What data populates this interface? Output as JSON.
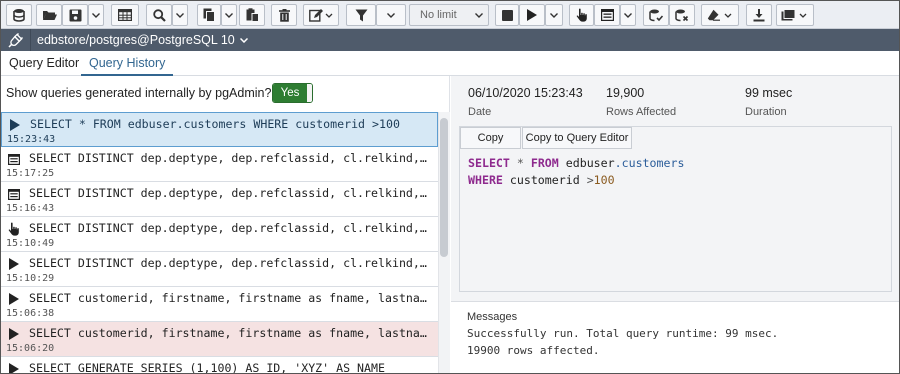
{
  "toolbar": {
    "limit_select_value": "No limit",
    "icons": [
      "database-icon",
      "folder-open-icon",
      "save-icon",
      "table-grid-icon",
      "search-icon",
      "copy-icon",
      "paste-icon",
      "trash-icon",
      "edit-icon",
      "filter-icon",
      "stop-icon",
      "play-icon",
      "pointer-explain-icon",
      "list-explain-icon",
      "commit-icon",
      "rollback-icon",
      "eraser-icon",
      "download-icon",
      "macros-icon"
    ]
  },
  "connection": {
    "label": "edbstore/postgres@PostgreSQL 10"
  },
  "tabs": [
    {
      "label": "Query Editor",
      "active": false
    },
    {
      "label": "Query History",
      "active": true
    }
  ],
  "history": {
    "show_internal_label": "Show queries generated internally by pgAdmin?",
    "toggle_label": "Yes",
    "toggle_on": true,
    "entries": [
      {
        "icon": "play-icon",
        "query": "SELECT * FROM edbuser.customers WHERE customerid >100",
        "time": "15:23:43",
        "state": "selected"
      },
      {
        "icon": "list-explain-icon",
        "query": "SELECT DISTINCT dep.deptype, dep.refclassid, cl.relkind,…",
        "time": "15:17:25",
        "state": "normal"
      },
      {
        "icon": "list-explain-icon",
        "query": "SELECT DISTINCT dep.deptype, dep.refclassid, cl.relkind,…",
        "time": "15:16:43",
        "state": "normal"
      },
      {
        "icon": "pointer-explain-icon",
        "query": "SELECT DISTINCT dep.deptype, dep.refclassid, cl.relkind,…",
        "time": "15:10:49",
        "state": "normal"
      },
      {
        "icon": "play-icon",
        "query": "SELECT DISTINCT dep.deptype, dep.refclassid, cl.relkind,…",
        "time": "15:10:29",
        "state": "normal"
      },
      {
        "icon": "play-icon",
        "query": "SELECT customerid, firstname, firstname as fname, lastna…",
        "time": "15:06:38",
        "state": "normal"
      },
      {
        "icon": "play-icon",
        "query": "SELECT customerid, firstname, firstname as fname, lastna…",
        "time": "15:06:20",
        "state": "error"
      },
      {
        "icon": "play-icon",
        "query": "SELECT GENERATE_SERIES (1,100) AS ID, 'XYZ' AS NAME",
        "time": "",
        "state": "normal"
      }
    ]
  },
  "detail": {
    "date_value": "06/10/2020 15:23:43",
    "date_label": "Date",
    "rows_value": "19,900",
    "rows_label": "Rows Affected",
    "duration_value": "99 msec",
    "duration_label": "Duration",
    "copy_button": "Copy",
    "copy_to_editor_button": "Copy to Query Editor",
    "sql": {
      "kw_select": "SELECT",
      "star": "*",
      "kw_from": "FROM",
      "schema": "edbuser",
      "dot_table": ".customers",
      "kw_where": "WHERE",
      "column": "customerid",
      "operator": ">",
      "number": "100"
    },
    "messages_title": "Messages",
    "messages_line1": "Successfully run. Total query runtime: 99 msec.",
    "messages_line2": "19900 rows affected."
  }
}
